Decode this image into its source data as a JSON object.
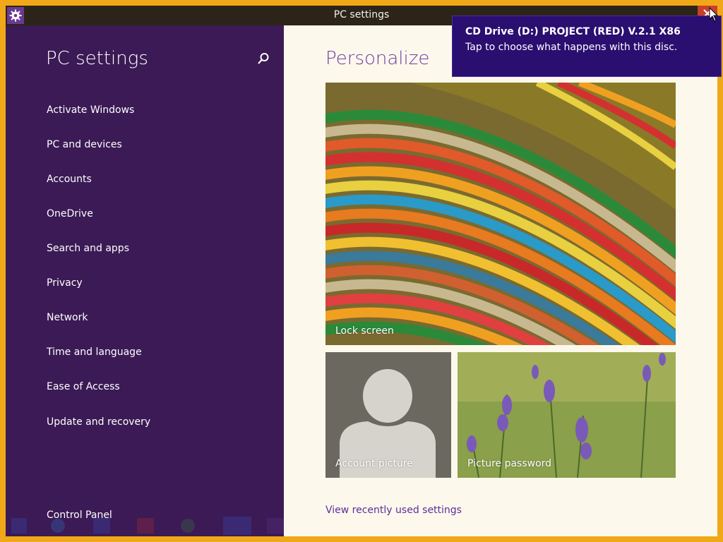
{
  "window": {
    "title": "PC settings"
  },
  "sidebar": {
    "title": "PC settings",
    "items": [
      {
        "label": "Activate Windows"
      },
      {
        "label": "PC and devices"
      },
      {
        "label": "Accounts"
      },
      {
        "label": "OneDrive"
      },
      {
        "label": "Search and apps"
      },
      {
        "label": "Privacy"
      },
      {
        "label": "Network"
      },
      {
        "label": "Time and language"
      },
      {
        "label": "Ease of Access"
      },
      {
        "label": "Update and recovery"
      }
    ],
    "footer": "Control Panel"
  },
  "main": {
    "title": "Personalize",
    "tiles": {
      "lock_screen": "Lock screen",
      "account_picture": "Account picture",
      "picture_password": "Picture password"
    },
    "recent_link": "View recently used settings"
  },
  "toast": {
    "title": "CD Drive (D:) PROJECT (RED) V.2.1 X86",
    "body": "Tap to choose what happens with this disc."
  },
  "colors": {
    "sidebar_bg": "#3b1a55",
    "accent": "#6b3fa0",
    "toast_bg": "#2a0e70",
    "screen_border": "#f0a818"
  },
  "icons": {
    "title_icon": "gear-icon",
    "search": "search-icon",
    "close": "close-icon"
  }
}
